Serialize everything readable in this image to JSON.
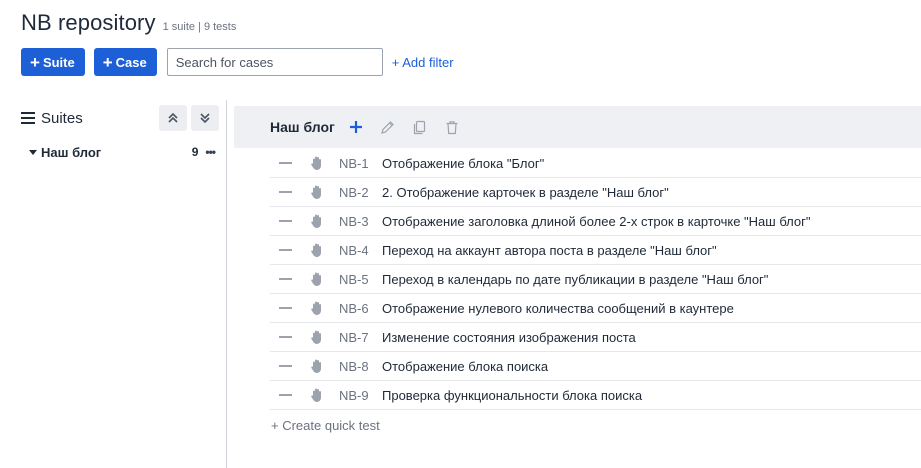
{
  "header": {
    "title": "NB repository",
    "subtitle": "1 suite | 9 tests"
  },
  "toolbar": {
    "suite_button": "Suite",
    "case_button": "Case",
    "search_placeholder": "Search for cases",
    "add_filter": "+ Add filter"
  },
  "sidebar": {
    "title": "Suites",
    "suite": {
      "name": "Наш блог",
      "count": "9",
      "menu": "•••"
    }
  },
  "suite_bar": {
    "title": "Наш блог"
  },
  "cases": [
    {
      "id": "NB-1",
      "title": "Отображение блока \"Блог\""
    },
    {
      "id": "NB-2",
      "title": "2. Отображение карточек в разделе \"Наш блог\""
    },
    {
      "id": "NB-3",
      "title": "Отображение заголовка длиной более 2-х строк в карточке \"Наш блог\""
    },
    {
      "id": "NB-4",
      "title": "Переход на аккаунт автора поста в разделе \"Наш блог\""
    },
    {
      "id": "NB-5",
      "title": "Переход в календарь по дате публикации в разделе \"Наш блог\""
    },
    {
      "id": "NB-6",
      "title": "Отображение нулевого количества сообщений в каунтере"
    },
    {
      "id": "NB-7",
      "title": "Изменение состояния изображения поста"
    },
    {
      "id": "NB-8",
      "title": "Отображение блока поиска"
    },
    {
      "id": "NB-9",
      "title": "Проверка функциональности блока поиска"
    }
  ],
  "quick_test": "+ Create quick test",
  "colors": {
    "accent": "#1d5fd6",
    "bar_bg": "#eef0f3",
    "muted": "#6b7280"
  }
}
